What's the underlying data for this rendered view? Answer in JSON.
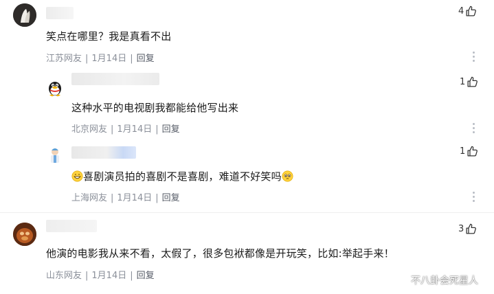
{
  "comments": [
    {
      "likes": "4",
      "text": "笑点在哪里？我是真看不出",
      "location": "江苏网友",
      "date": "1月14日",
      "reply": "回复"
    },
    {
      "likes": "1",
      "text": "这种水平的电视剧我都能给他写出来",
      "location": "北京网友",
      "date": "1月14日",
      "reply": "回复"
    },
    {
      "likes": "1",
      "text": "喜剧演员拍的喜剧不是喜剧，难道不好笑吗",
      "location": "上海网友",
      "date": "1月14日",
      "reply": "回复"
    },
    {
      "likes": "3",
      "text": "他演的电影我从来不看，太假了，很多包袱都像是开玩笑，比如:举起手来！",
      "location": "山东网友",
      "date": "1月14日",
      "reply": "回复"
    }
  ],
  "separator": "|",
  "watermark": "不八卦会死星人",
  "icons": {
    "like": "thumbs-up-icon",
    "more": "more-vertical-icon",
    "emoji_grin": "grinning-face-emoji",
    "emoji_pleading": "pleading-face-emoji"
  },
  "colors": {
    "meta": "#8a8f99",
    "reply": "#555b66",
    "text": "#1a1a1a"
  }
}
